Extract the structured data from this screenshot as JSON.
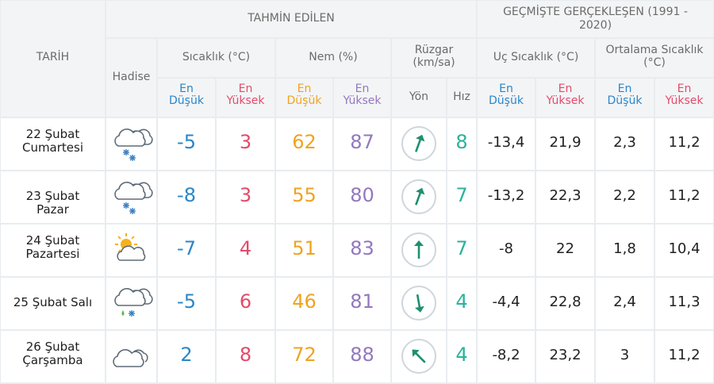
{
  "headers": {
    "tarih": "TARİH",
    "tahmin": "TAHMİN EDİLEN",
    "gecmis": "GEÇMİŞTE GERÇEKLEŞEN (1991 - 2020)",
    "hadise": "Hadise",
    "sicaklik": "Sıcaklık (°C)",
    "nem": "Nem (%)",
    "ruzgar": "Rüzgar (km/sa)",
    "uc": "Uç Sıcaklık (°C)",
    "ortalama": "Ortalama Sıcaklık (°C)",
    "en_dusuk": "En Düşük",
    "en_yuksek": "En Yüksek",
    "yon": "Yön",
    "hiz": "Hız"
  },
  "colors": {
    "blue": "#2a86c8",
    "red": "#e34b6a",
    "orange": "#f0a31f",
    "purple": "#9278be",
    "teal": "#2ab29a",
    "header_bg": "#f3f4f6"
  },
  "rows": [
    {
      "date": "22 Şubat Cumartesi",
      "icon": "cloud-snow-icon",
      "temp_min": "-5",
      "temp_max": "3",
      "hum_min": "62",
      "hum_max": "87",
      "wind_dir_deg": 200,
      "wind_speed": "8",
      "ext_min": "-13,4",
      "ext_max": "21,9",
      "avg_min": "2,3",
      "avg_max": "11,2"
    },
    {
      "date": "23 Şubat Pazar",
      "icon": "cloud-snow-icon",
      "temp_min": "-8",
      "temp_max": "3",
      "hum_min": "55",
      "hum_max": "80",
      "wind_dir_deg": 200,
      "wind_speed": "7",
      "ext_min": "-13,2",
      "ext_max": "22,3",
      "avg_min": "2,2",
      "avg_max": "11,2"
    },
    {
      "date": "24 Şubat Pazartesi",
      "icon": "sun-cloud-icon",
      "temp_min": "-7",
      "temp_max": "4",
      "hum_min": "51",
      "hum_max": "83",
      "wind_dir_deg": 180,
      "wind_speed": "7",
      "ext_min": "-8",
      "ext_max": "22",
      "avg_min": "1,8",
      "avg_max": "10,4"
    },
    {
      "date": "25 Şubat Salı",
      "icon": "cloud-sleet-icon",
      "temp_min": "-5",
      "temp_max": "6",
      "hum_min": "46",
      "hum_max": "81",
      "wind_dir_deg": 350,
      "wind_speed": "4",
      "ext_min": "-4,4",
      "ext_max": "22,8",
      "avg_min": "2,4",
      "avg_max": "11,3"
    },
    {
      "date": "26 Şubat Çarşamba",
      "icon": "cloud-icon",
      "temp_min": "2",
      "temp_max": "8",
      "hum_min": "72",
      "hum_max": "88",
      "wind_dir_deg": 135,
      "wind_speed": "4",
      "ext_min": "-8,2",
      "ext_max": "23,2",
      "avg_min": "3",
      "avg_max": "11,2"
    }
  ]
}
